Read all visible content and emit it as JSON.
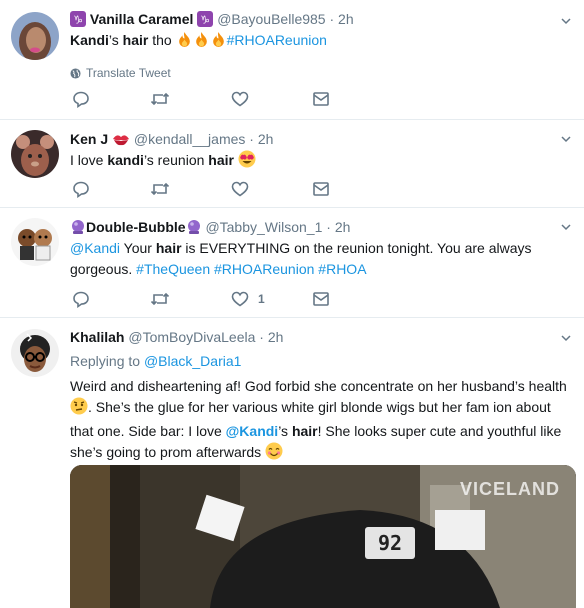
{
  "tweets": [
    {
      "name": "Vanilla Caramel",
      "handle": "@BayouBelle985",
      "time": "2h",
      "body": [
        "Kandi",
        "’s ",
        "hair",
        " tho ",
        "#RHOAReunion"
      ],
      "translate_label": "Translate Tweet"
    },
    {
      "name": "Ken J",
      "handle": "@kendall__james",
      "time": "2h",
      "body": [
        "I love ",
        "kandi",
        "’s reunion ",
        "hair"
      ]
    },
    {
      "name": "Double-Bubble",
      "handle": "@Tabby_Wilson_1",
      "time": "2h",
      "body": [
        "@Kandi",
        " Your ",
        "hair",
        " is EVERYTHING on the reunion tonight. You are always gorgeous. ",
        "#TheQueen",
        " ",
        "#RHOAReunion",
        " ",
        "#RHOA"
      ],
      "like_count": "1"
    },
    {
      "name": "Khalilah",
      "handle": "@TomBoyDivaLeela",
      "time": "2h",
      "replying_label": "Replying to",
      "replying_to": "@Black_Daria1",
      "body": [
        "Weird and disheartening af! God forbid she concentrate on her husband’s health ",
        ". She’s the glue for her various white girl  blonde wigs but her fam ion about that one. Side bar: I love ",
        "@Kandi",
        "’s ",
        "hair",
        "! She looks super cute and youthful like she’s going to prom afterwards "
      ],
      "media_watermark": "VICELAND",
      "cap_text": "92"
    }
  ],
  "dot": "·",
  "icons": [
    "reply-icon",
    "retweet-icon",
    "like-icon",
    "message-icon",
    "globe-icon",
    "chevron-down-icon"
  ],
  "colors": {
    "link": "#1b95e0",
    "secondary": "#657786",
    "divider": "#e6ecf0"
  }
}
